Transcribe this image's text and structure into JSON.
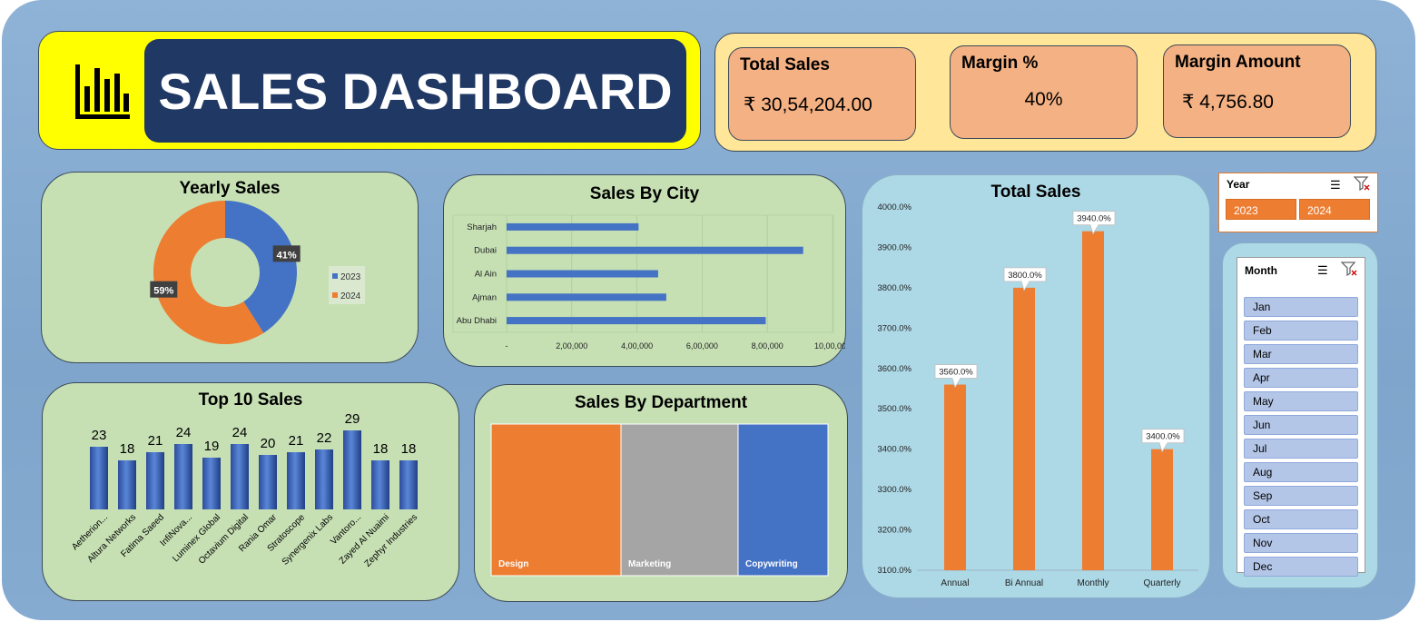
{
  "header": {
    "title": "SALES DASHBOARD",
    "icon": "bar-chart-icon"
  },
  "kpis": {
    "total_sales": {
      "label": "Total Sales",
      "value": "₹  30,54,204.00"
    },
    "margin_pct": {
      "label": "Margin %",
      "value": "40%"
    },
    "margin_amount": {
      "label": "Margin Amount",
      "value": "₹  4,756.80"
    }
  },
  "slicers": {
    "year": {
      "title": "Year",
      "options": [
        "2023",
        "2024"
      ]
    },
    "month": {
      "title": "Month",
      "options": [
        "Jan",
        "Feb",
        "Mar",
        "Apr",
        "May",
        "Jun",
        "Jul",
        "Aug",
        "Sep",
        "Oct",
        "Nov",
        "Dec"
      ]
    }
  },
  "colors": {
    "orange": "#ed7d31",
    "blue": "#4472c4",
    "gray": "#a5a5a5",
    "navy": "#203864",
    "yellow": "#ffff00"
  },
  "chart_data": [
    {
      "id": "yearly",
      "type": "pie",
      "title": "Yearly Sales",
      "categories": [
        "2023",
        "2024"
      ],
      "values": [
        41,
        59
      ],
      "labels": [
        "41%",
        "59%"
      ],
      "legend": "right"
    },
    {
      "id": "city",
      "type": "bar",
      "orientation": "horizontal",
      "title": "Sales By City",
      "categories": [
        "Sharjah",
        "Dubai",
        "Al Ain",
        "Ajman",
        "Abu Dhabi"
      ],
      "values": [
        405000,
        910000,
        465000,
        490000,
        795000
      ],
      "xlim": [
        0,
        1000000
      ],
      "xticks": [
        "-",
        "2,00,000",
        "4,00,000",
        "6,00,000",
        "8,00,000",
        "10,00,000"
      ],
      "grid": true
    },
    {
      "id": "total",
      "type": "bar",
      "title": "Total Sales",
      "categories": [
        "Annual",
        "Bi Annual",
        "Monthly",
        "Quarterly"
      ],
      "values": [
        3560,
        3800,
        3940,
        3400
      ],
      "labels": [
        "3560.0%",
        "3800.0%",
        "3940.0%",
        "3400.0%"
      ],
      "ylim": [
        3100,
        4000
      ],
      "yticks": [
        "3100.0%",
        "3200.0%",
        "3300.0%",
        "3400.0%",
        "3500.0%",
        "3600.0%",
        "3700.0%",
        "3800.0%",
        "3900.0%",
        "4000.0%"
      ]
    },
    {
      "id": "top10",
      "type": "bar",
      "title": "Top 10 Sales",
      "categories": [
        "Aetherion...",
        "Altura Networks",
        "Fatima Saeed",
        "InfiNova...",
        "Luminex Global",
        "Octavium Digital",
        "Rania Omar",
        "Stratoscope",
        "Synergenix Labs",
        "Vantoro...",
        "Zayed Al Nuaimi",
        "Zephyr Industries"
      ],
      "values": [
        23,
        18,
        21,
        24,
        19,
        24,
        20,
        21,
        22,
        29,
        18,
        18
      ],
      "ylim": [
        0,
        30
      ]
    },
    {
      "id": "dept",
      "type": "treemap",
      "title": "Sales By Department",
      "categories": [
        "Design",
        "Marketing",
        "Copywriting"
      ],
      "values": [
        143,
        129,
        99
      ]
    }
  ]
}
